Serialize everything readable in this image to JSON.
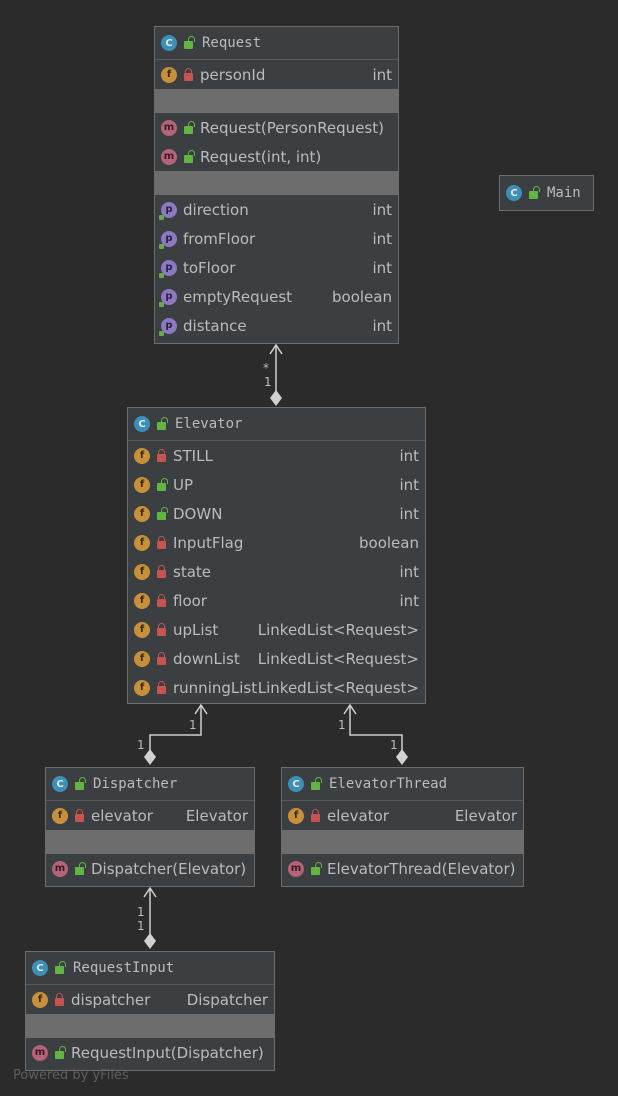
{
  "classes": {
    "request": {
      "name": "Request",
      "fields": [
        {
          "name": "personId",
          "type": "int"
        }
      ],
      "methods": [
        {
          "name": "Request(PersonRequest)"
        },
        {
          "name": "Request(int, int)"
        }
      ],
      "properties": [
        {
          "name": "direction",
          "type": "int"
        },
        {
          "name": "fromFloor",
          "type": "int"
        },
        {
          "name": "toFloor",
          "type": "int"
        },
        {
          "name": "emptyRequest",
          "type": "boolean"
        },
        {
          "name": "distance",
          "type": "int"
        }
      ]
    },
    "main": {
      "name": "Main"
    },
    "elevator": {
      "name": "Elevator",
      "fields": [
        {
          "name": "STILL",
          "type": "int"
        },
        {
          "name": "UP",
          "type": "int"
        },
        {
          "name": "DOWN",
          "type": "int"
        },
        {
          "name": "InputFlag",
          "type": "boolean"
        },
        {
          "name": "state",
          "type": "int"
        },
        {
          "name": "floor",
          "type": "int"
        },
        {
          "name": "upList",
          "type": "LinkedList<Request>"
        },
        {
          "name": "downList",
          "type": "LinkedList<Request>"
        },
        {
          "name": "runningList",
          "type": "LinkedList<Request>"
        }
      ]
    },
    "dispatcher": {
      "name": "Dispatcher",
      "fields": [
        {
          "name": "elevator",
          "type": "Elevator"
        }
      ],
      "methods": [
        {
          "name": "Dispatcher(Elevator)"
        }
      ]
    },
    "elevator_thread": {
      "name": "ElevatorThread",
      "fields": [
        {
          "name": "elevator",
          "type": "Elevator"
        }
      ],
      "methods": [
        {
          "name": "ElevatorThread(Elevator)"
        }
      ]
    },
    "request_input": {
      "name": "RequestInput",
      "fields": [
        {
          "name": "dispatcher",
          "type": "Dispatcher"
        }
      ],
      "methods": [
        {
          "name": "RequestInput(Dispatcher)"
        }
      ]
    }
  },
  "edges": {
    "request_elevator": {
      "target_mult": "*",
      "source_mult": "1"
    },
    "dispatcher_elevator": {
      "target_mult": "1",
      "source_mult": "1"
    },
    "thread_elevator": {
      "target_mult": "1",
      "source_mult": "1"
    },
    "input_dispatcher": {
      "target_mult": "1",
      "source_mult": "1"
    }
  },
  "icons": {
    "class": "C",
    "field": "f",
    "method": "m",
    "property": "p"
  },
  "colors": {
    "background": "#2b2b2b",
    "node": "#3c3f41",
    "edge": "#d0d0d0"
  },
  "watermark": "Powered by yFiles"
}
